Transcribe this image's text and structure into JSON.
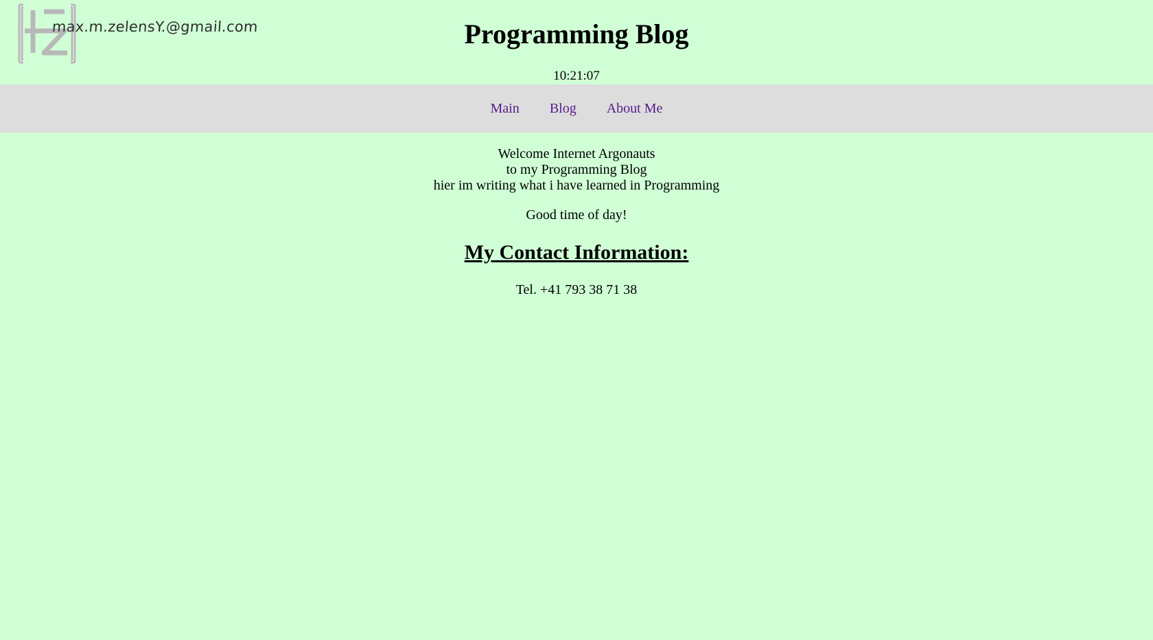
{
  "header": {
    "logo": {
      "icon": "mz-monogram-logo",
      "email_text": "max.m.zelensY.@gmail.com"
    },
    "title": "Programming Blog",
    "clock": "10:21:07"
  },
  "nav": {
    "items": [
      {
        "label": "Main"
      },
      {
        "label": "Blog"
      },
      {
        "label": "About Me"
      }
    ],
    "link_color": "#551a8b",
    "background": "#dddddd"
  },
  "main": {
    "intro_lines": [
      "Welcome Internet Argonauts",
      "to my Programming Blog",
      "hier im writing what i have learned in Programming"
    ],
    "greeting": "Good time of day!",
    "contact_heading": "My Contact Information:",
    "phone": "Tel. +41 793 38 71 38"
  },
  "colors": {
    "page_background": "#d0ffd6"
  }
}
